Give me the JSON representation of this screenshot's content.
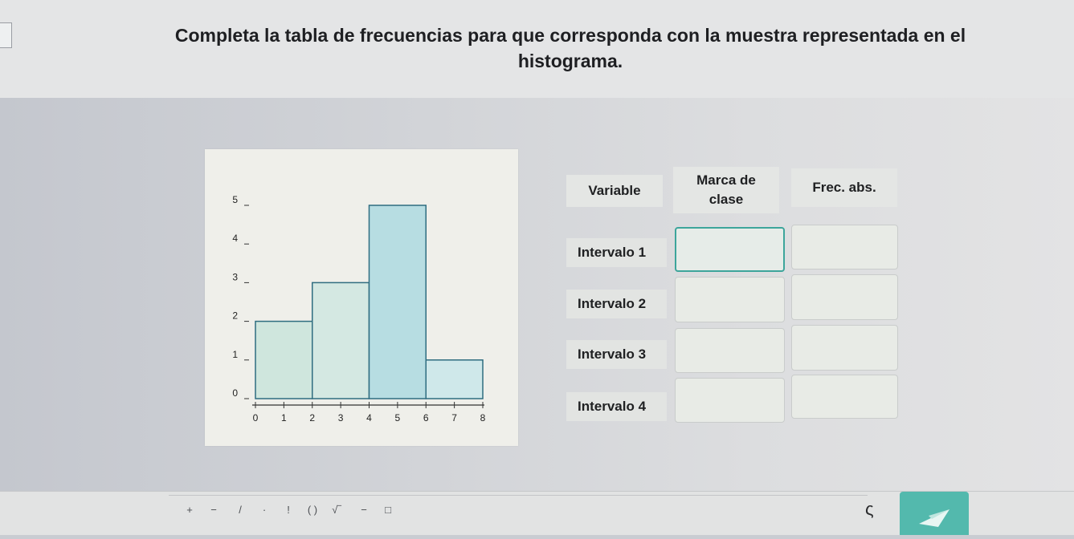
{
  "header": {
    "prompt": "Completa la tabla de frecuencias para que corresponda con la muestra representada en el histograma."
  },
  "table": {
    "col_variable": "Variable",
    "col_marca_line1": "Marca de",
    "col_marca_line2": "clase",
    "col_frec": "Frec. abs.",
    "rows": [
      {
        "label": "Intervalo 1",
        "marca": "",
        "frec": ""
      },
      {
        "label": "Intervalo 2",
        "marca": "",
        "frec": ""
      },
      {
        "label": "Intervalo 3",
        "marca": "",
        "frec": ""
      },
      {
        "label": "Intervalo 4",
        "marca": "",
        "frec": ""
      }
    ]
  },
  "chart_data": {
    "type": "bar",
    "bins": [
      {
        "from": 0,
        "to": 2,
        "value": 2
      },
      {
        "from": 2,
        "to": 4,
        "value": 3
      },
      {
        "from": 4,
        "to": 6,
        "value": 5
      },
      {
        "from": 6,
        "to": 8,
        "value": 1
      }
    ],
    "xticks": [
      "0",
      "1",
      "2",
      "3",
      "4",
      "5",
      "6",
      "7",
      "8"
    ],
    "yticks": [
      "0",
      "1",
      "2",
      "3",
      "4",
      "5"
    ],
    "xlim": [
      0,
      8
    ],
    "ylim": [
      0,
      5
    ],
    "bar_colors": [
      "#cfe6dd",
      "#d4e8e2",
      "#b7dde2",
      "#cfe8ea"
    ],
    "stroke_color": "#2f6d80",
    "title": "",
    "xlabel": "",
    "ylabel": ""
  },
  "toolbar": {
    "buttons": [
      {
        "name": "plus-button",
        "label": "+"
      },
      {
        "name": "minus-button",
        "label": "−"
      },
      {
        "name": "divide-button",
        "label": "/"
      },
      {
        "name": "dot-button",
        "label": "·"
      },
      {
        "name": "factorial-button",
        "label": "!"
      },
      {
        "name": "parentheses-button",
        "label": "( )"
      },
      {
        "name": "sqrt-button",
        "label": "√‾"
      },
      {
        "name": "fraction-button",
        "label": "−"
      },
      {
        "name": "box-button",
        "label": "□"
      }
    ],
    "colors": {
      "send": "#53b9ad"
    }
  }
}
